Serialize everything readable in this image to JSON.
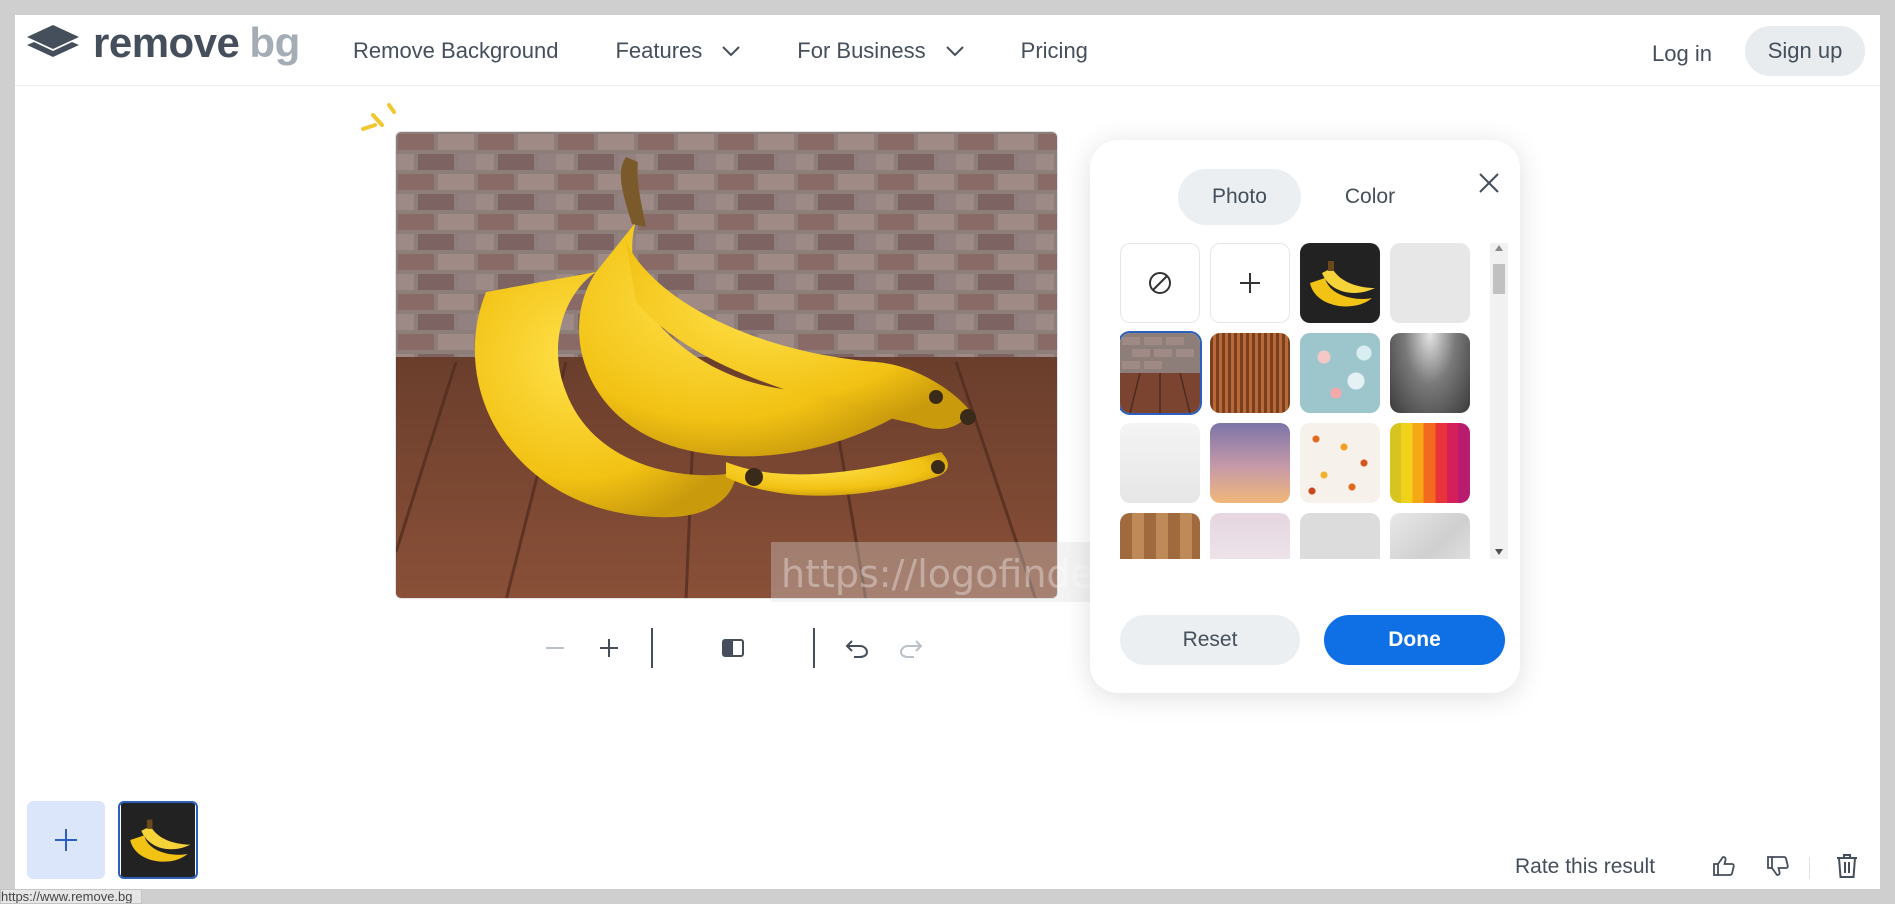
{
  "header": {
    "logo_main": "remove",
    "logo_accent": "bg",
    "nav": [
      {
        "label": "Remove Background",
        "dropdown": false
      },
      {
        "label": "Features",
        "dropdown": true
      },
      {
        "label": "For Business",
        "dropdown": true
      },
      {
        "label": "Pricing",
        "dropdown": false
      }
    ],
    "login": "Log in",
    "signup": "Sign up"
  },
  "editor": {
    "watermark": "https://logofinder.com",
    "toolbar": [
      "zoom-out",
      "zoom-in",
      "compare",
      "undo",
      "redo"
    ]
  },
  "panel": {
    "tabs": {
      "photo": "Photo",
      "color": "Color"
    },
    "active_tab": "Photo",
    "reset": "Reset",
    "done": "Done",
    "tiles": [
      "no-background",
      "add-photo",
      "bananas-dark",
      "light-gray",
      "brick-wood",
      "copper-stripes",
      "bokeh",
      "dark-spotlight",
      "white-soft",
      "purple-sunset",
      "confetti-dots",
      "rainbow-stripes",
      "wood-planks",
      "lavender-fade",
      "gray-plain",
      "marble"
    ],
    "selected_tile": "brick-wood"
  },
  "footer": {
    "rate": "Rate this result",
    "status_url": "https://www.remove.bg"
  },
  "colors": {
    "accent": "#0f70e6",
    "text": "#454f5b",
    "pill": "#eceff1"
  }
}
